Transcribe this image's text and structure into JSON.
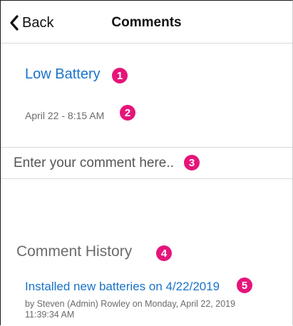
{
  "nav": {
    "back_label": "Back",
    "title": "Comments"
  },
  "alert": {
    "title": "Low Battery",
    "date": "April 22 - 8:15 AM"
  },
  "comment_input": {
    "placeholder": "Enter your comment here.."
  },
  "history": {
    "section_title": "Comment History",
    "entries": [
      {
        "text": "Installed new batteries on 4/22/2019",
        "meta": "by Steven  (Admin) Rowley on Monday, April 22, 2019 11:39:34 AM"
      }
    ]
  },
  "annotations": [
    "1",
    "2",
    "3",
    "4",
    "5"
  ],
  "colors": {
    "link": "#1a73c8",
    "badge": "#e5157a",
    "muted_text": "#6b6b6b"
  },
  "icons": {
    "back": "chevron-left-icon"
  }
}
